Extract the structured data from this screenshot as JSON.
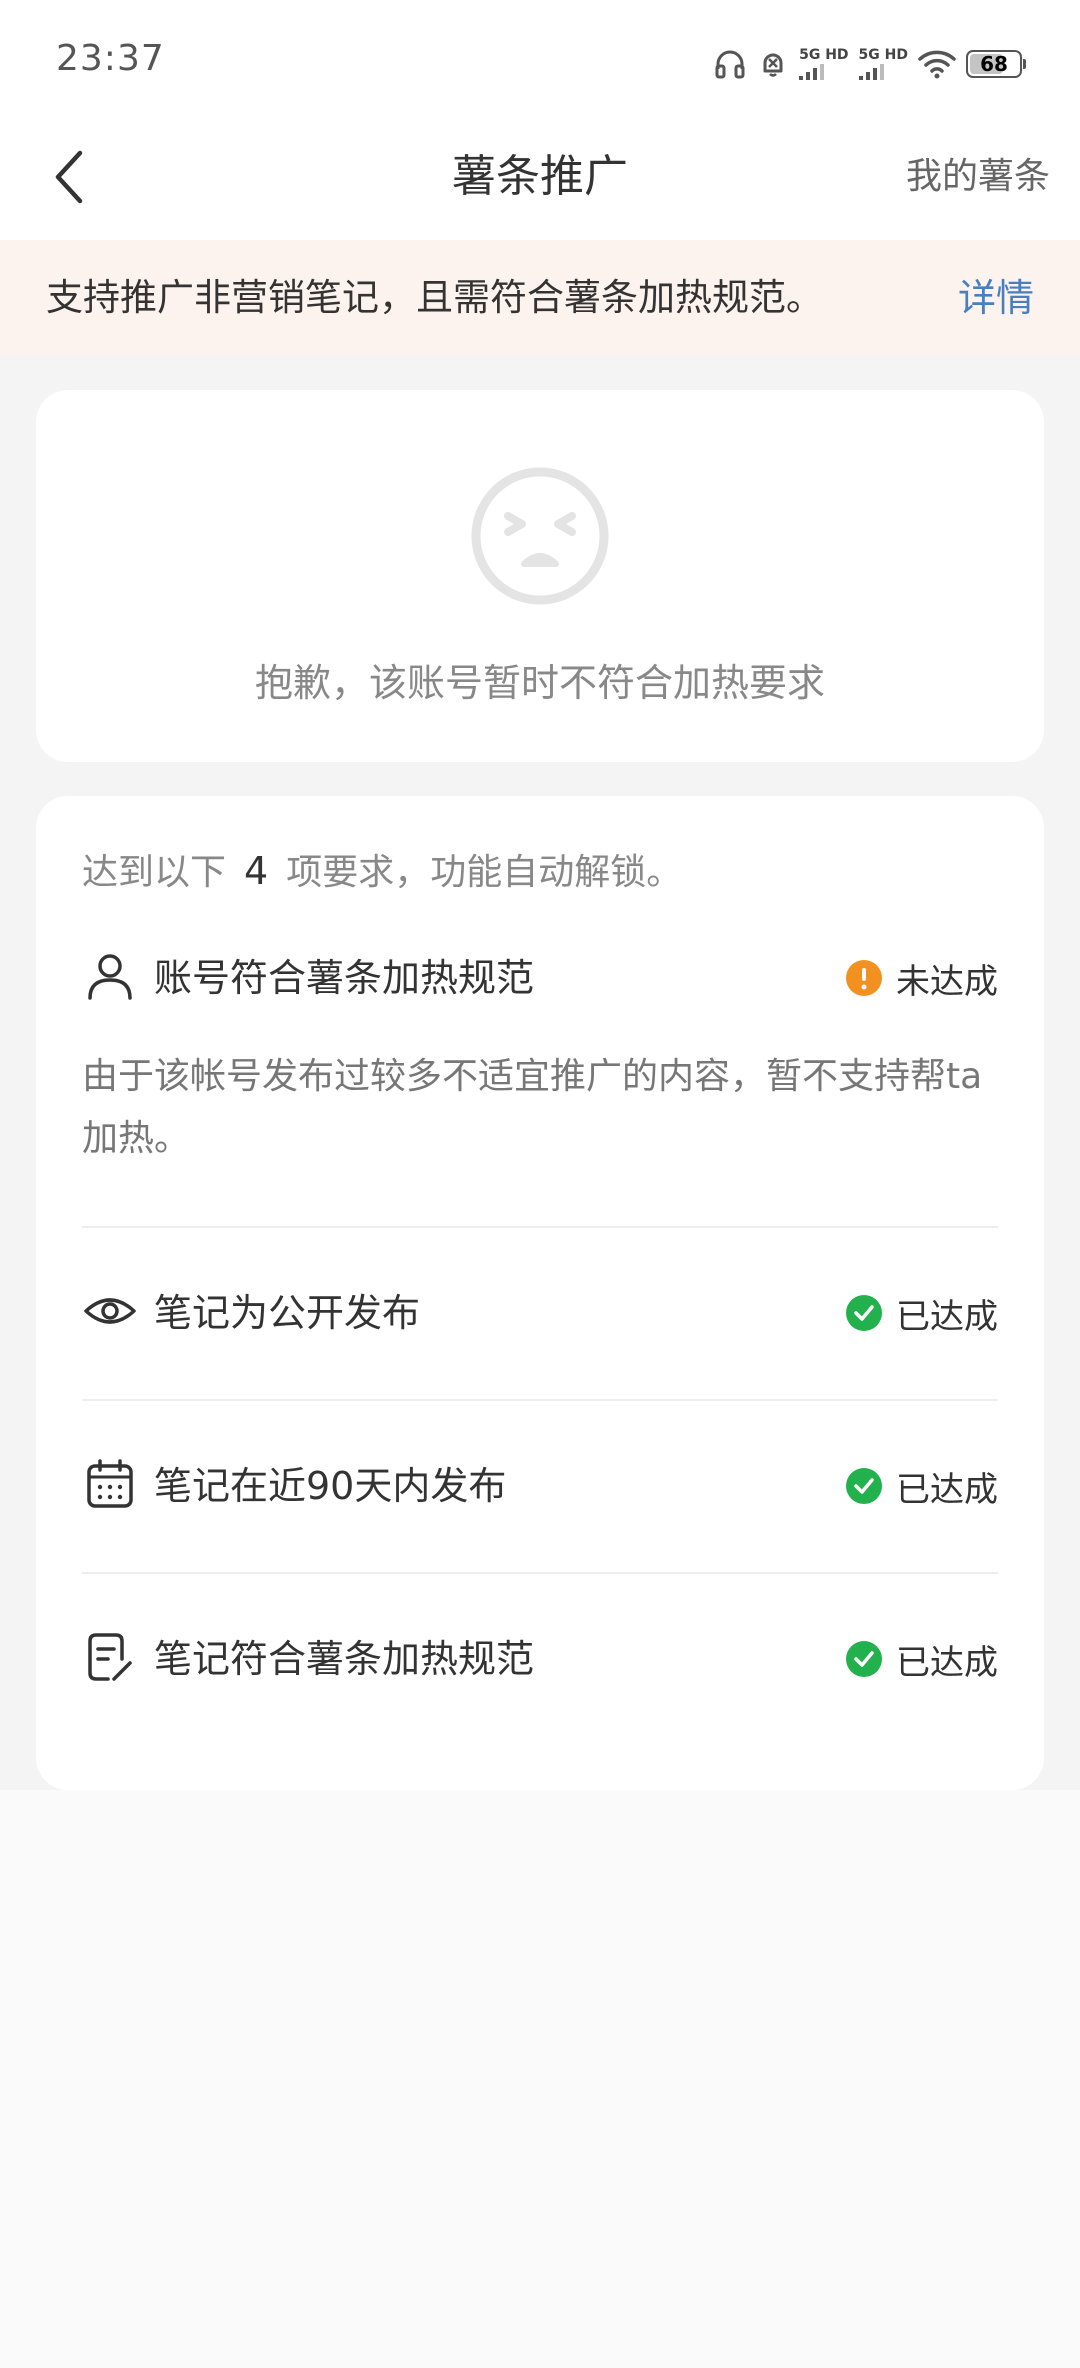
{
  "status_bar": {
    "time": "23:37",
    "sim1_label": "5G HD",
    "sim2_label": "5G HD",
    "battery_level": "68",
    "battery_fraction": 0.68
  },
  "nav": {
    "title": "薯条推广",
    "right_link": "我的薯条"
  },
  "notice": {
    "text": "支持推广非营销笔记，且需符合薯条加热规范。",
    "link": "详情"
  },
  "sorry_card": {
    "message": "抱歉，该账号暂时不符合加热要求"
  },
  "requirements": {
    "header_prefix": "达到以下",
    "count": "4",
    "header_suffix": "项要求，功能自动解锁。",
    "items": [
      {
        "icon": "person-icon",
        "label": "账号符合薯条加热规范",
        "status": "未达成",
        "status_type": "warn",
        "description": "由于该帐号发布过较多不适宜推广的内容，暂不支持帮ta加热。"
      },
      {
        "icon": "eye-icon",
        "label": "笔记为公开发布",
        "status": "已达成",
        "status_type": "ok"
      },
      {
        "icon": "calendar-icon",
        "label": "笔记在近90天内发布",
        "status": "已达成",
        "status_type": "ok"
      },
      {
        "icon": "note-edit-icon",
        "label": "笔记符合薯条加热规范",
        "status": "已达成",
        "status_type": "ok"
      }
    ]
  },
  "colors": {
    "notice_bg": "#fdf3ee",
    "link": "#4a7fbf",
    "warn": "#f29020",
    "ok": "#22b14c"
  }
}
